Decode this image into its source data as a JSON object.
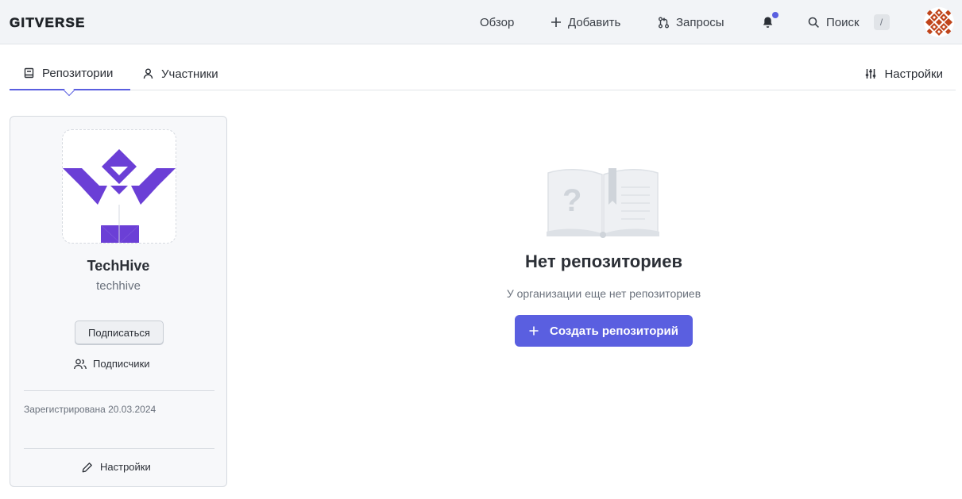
{
  "brand": {
    "logo_text": "GITVERSE"
  },
  "header": {
    "nav": {
      "overview": "Обзор",
      "add": "Добавить",
      "requests": "Запросы",
      "search": "Поиск",
      "search_shortcut": "/"
    },
    "notification_dot_color": "#5a5fe0"
  },
  "tabs": {
    "repositories": "Репозитории",
    "members": "Участники",
    "settings": "Настройки"
  },
  "org": {
    "name": "TechHive",
    "login": "techhive",
    "follow_label": "Подписаться",
    "followers_label": "Подписчики",
    "registered": "Зарегистрирована 20.03.2024",
    "settings_label": "Настройки",
    "logo_color": "#6b3fd6"
  },
  "empty_state": {
    "title": "Нет репозиториев",
    "subtitle": "У организации еще нет репозиториев",
    "create_label": "Создать репозиторий"
  },
  "colors": {
    "accent": "#5a5fe0",
    "avatar": "#c0441a"
  }
}
